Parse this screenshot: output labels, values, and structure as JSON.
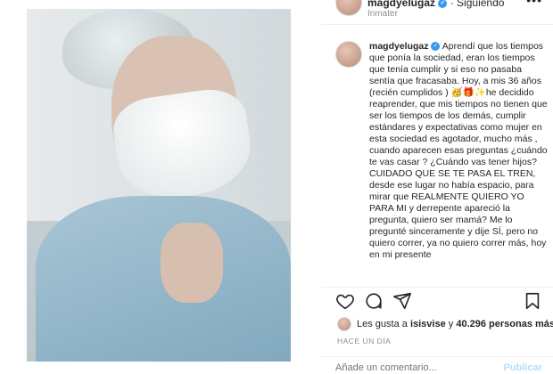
{
  "post": {
    "username": "magdyelugaz",
    "header_status": "· Siguiendo",
    "location": "Inmater",
    "more_label": "•••",
    "caption": "Aprendí que los tiempos que ponía la sociedad, eran los tiempos que tenía cumplir y si eso no pasaba sentía que fracasaba. Hoy, a mis 36 años (recién cumplidos ) 🥳🎁✨he decidido reaprender, que mis tiempos no tienen que ser los tiempos de los demás, cumplir estándares y expectativas como mujer en esta sociedad es agotador, mucho más , cuando aparecen esas preguntas ¿cuándo te vas casar ? ¿Cuándo vas tener hijos? CUIDADO QUE SE TE PASA EL TREN, desde ese lugar no había espacio, para mirar que REALMENTE QUIERO YO PARA MI y derrepente apareció la pregunta, quiero ser mamá? Me lo pregunté sinceramente y dije SÍ, pero no quiero correr, ya no quiero correr más, hoy en mi presente"
  },
  "likes": {
    "prefix": "Les gusta a",
    "user": "isisvise",
    "connector": "y",
    "count": "40.296 personas más"
  },
  "timestamp": "HACE UN DÍA",
  "comment": {
    "placeholder": "Añade un comentario...",
    "publish_label": "Publicar"
  },
  "icons": [
    "heart-icon",
    "comment-icon",
    "share-icon",
    "bookmark-icon"
  ]
}
